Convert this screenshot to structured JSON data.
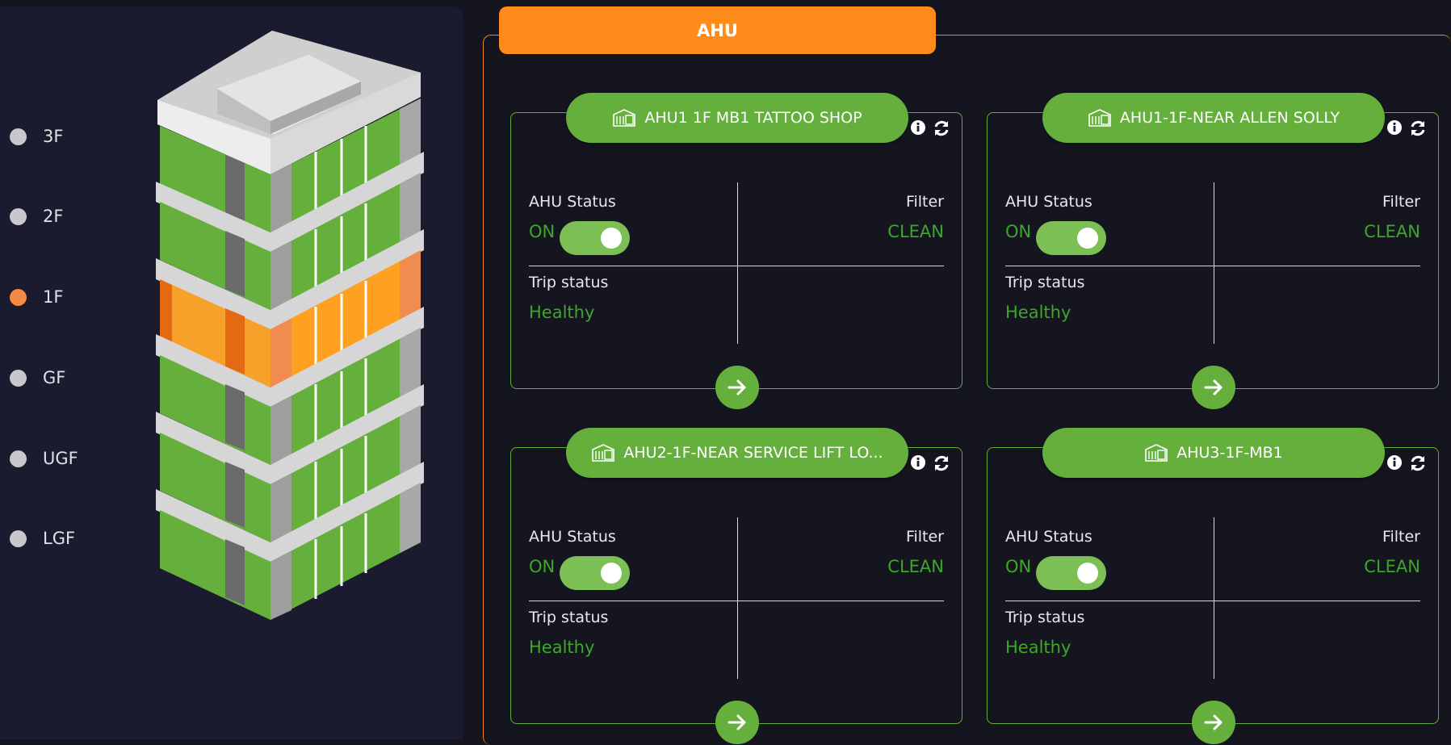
{
  "floors": [
    {
      "label": "3F",
      "active": false
    },
    {
      "label": "2F",
      "active": false
    },
    {
      "label": "1F",
      "active": true
    },
    {
      "label": "GF",
      "active": false
    },
    {
      "label": "UGF",
      "active": false
    },
    {
      "label": "LGF",
      "active": false
    }
  ],
  "colors": {
    "accent": "#ff8c1a",
    "card_green": "#65b03c",
    "status_green": "#3ea62a",
    "active_floor": "#f38b44",
    "panel_bg": "#1a1b2e"
  },
  "ahu_tab": {
    "title": "AHU"
  },
  "cards": [
    {
      "title": "AHU1 1F MB1 TATTOO SHOP",
      "ahu_status_label": "AHU Status",
      "ahu_status_value": "ON",
      "toggle_on": true,
      "filter_label": "Filter",
      "filter_value": "CLEAN",
      "trip_label": "Trip status",
      "trip_value": "Healthy"
    },
    {
      "title": "AHU1-1F-NEAR ALLEN SOLLY",
      "ahu_status_label": "AHU Status",
      "ahu_status_value": "ON",
      "toggle_on": true,
      "filter_label": "Filter",
      "filter_value": "CLEAN",
      "trip_label": "Trip status",
      "trip_value": "Healthy"
    },
    {
      "title": "AHU2-1F-NEAR SERVICE LIFT LO...",
      "ahu_status_label": "AHU Status",
      "ahu_status_value": "ON",
      "toggle_on": true,
      "filter_label": "Filter",
      "filter_value": "CLEAN",
      "trip_label": "Trip status",
      "trip_value": "Healthy"
    },
    {
      "title": "AHU3-1F-MB1",
      "ahu_status_label": "AHU Status",
      "ahu_status_value": "ON",
      "toggle_on": true,
      "filter_label": "Filter",
      "filter_value": "CLEAN",
      "trip_label": "Trip status",
      "trip_value": "Healthy"
    }
  ],
  "icons": {
    "card_title": "ahu-unit-icon",
    "info": "info-icon",
    "refresh": "refresh-icon",
    "go": "arrow-right-icon"
  }
}
